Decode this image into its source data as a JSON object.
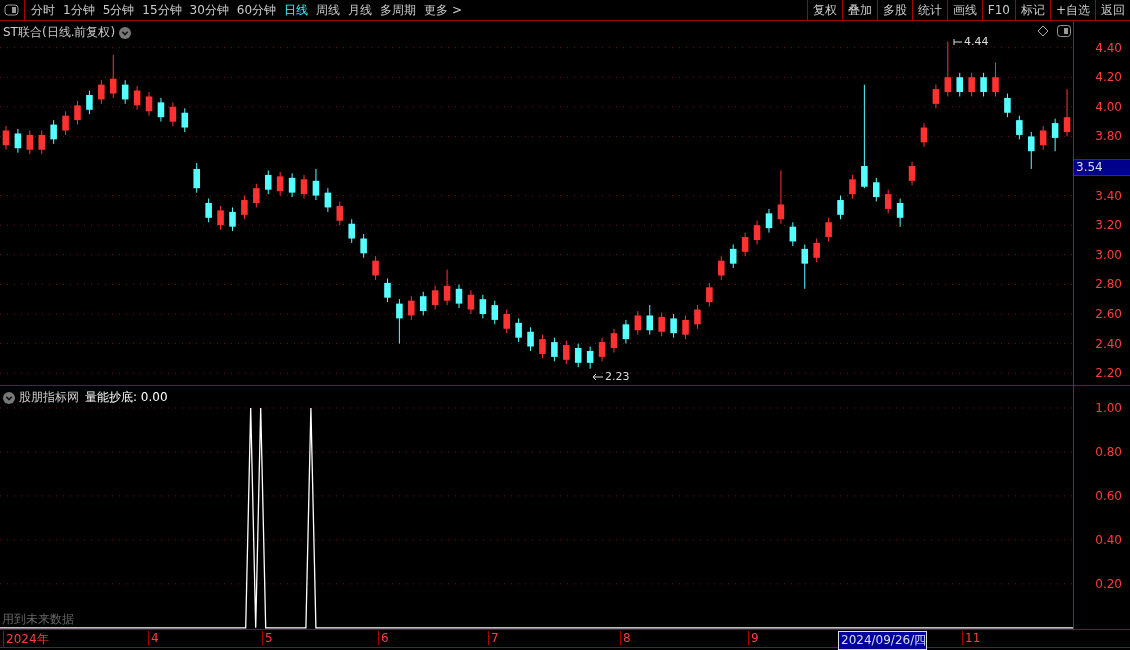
{
  "toolbar": {
    "periods": [
      {
        "label": "分时",
        "selected": false
      },
      {
        "label": "1分钟",
        "selected": false
      },
      {
        "label": "5分钟",
        "selected": false
      },
      {
        "label": "15分钟",
        "selected": false
      },
      {
        "label": "30分钟",
        "selected": false
      },
      {
        "label": "60分钟",
        "selected": false
      },
      {
        "label": "日线",
        "selected": true
      },
      {
        "label": "周线",
        "selected": false
      },
      {
        "label": "月线",
        "selected": false
      },
      {
        "label": "多周期",
        "selected": false
      },
      {
        "label": "更多 >",
        "selected": false
      }
    ],
    "buttons": [
      "复权",
      "叠加",
      "多股",
      "统计",
      "画线",
      "F10",
      "标记",
      "+自选",
      "返回"
    ]
  },
  "main_chart": {
    "title": "ST联合(日线.前复权)",
    "current_price": "3.54",
    "high_marker": "4.44",
    "low_marker": "2.23",
    "chart_data": {
      "type": "candlestick",
      "grid": true,
      "ylim": [
        2.12,
        4.58
      ],
      "categories": [
        null,
        null,
        null,
        null,
        null,
        null,
        null,
        null,
        null,
        null,
        null,
        null,
        null,
        null,
        null,
        null,
        null,
        null,
        null,
        null,
        null,
        null,
        null,
        null,
        null,
        null,
        null,
        null,
        null,
        null,
        null,
        null,
        null,
        null,
        null,
        null,
        null,
        null,
        null,
        null,
        null,
        null,
        null,
        null,
        null,
        null,
        null,
        null,
        null,
        null,
        null,
        null,
        null,
        null,
        null,
        null,
        null,
        null,
        null,
        null,
        null,
        null,
        null,
        null,
        null,
        null,
        null,
        null,
        null,
        null,
        null,
        null,
        null,
        null,
        null,
        null,
        null,
        null,
        null,
        null,
        null,
        null,
        null,
        null,
        null,
        null,
        null,
        null,
        null,
        null
      ],
      "ohlc": [
        [
          3.74,
          3.87,
          3.71,
          3.84
        ],
        [
          3.82,
          3.85,
          3.69,
          3.72
        ],
        [
          3.71,
          3.84,
          3.68,
          3.81
        ],
        [
          3.71,
          3.84,
          3.68,
          3.81
        ],
        [
          3.88,
          3.91,
          3.75,
          3.78
        ],
        [
          3.84,
          3.97,
          3.81,
          3.94
        ],
        [
          3.91,
          4.04,
          3.88,
          4.01
        ],
        [
          4.08,
          4.11,
          3.95,
          3.98
        ],
        [
          4.05,
          4.18,
          4.02,
          4.15
        ],
        [
          4.09,
          4.35,
          4.06,
          4.19
        ],
        [
          4.15,
          4.18,
          4.02,
          4.05
        ],
        [
          4.01,
          4.14,
          3.98,
          4.11
        ],
        [
          3.97,
          4.1,
          3.94,
          4.07
        ],
        [
          4.03,
          4.06,
          3.9,
          3.93
        ],
        [
          3.9,
          4.03,
          3.87,
          4.0
        ],
        [
          3.96,
          3.99,
          3.83,
          3.86
        ],
        [
          3.58,
          3.62,
          3.42,
          3.45
        ],
        [
          3.35,
          3.38,
          3.22,
          3.25
        ],
        [
          3.2,
          3.33,
          3.17,
          3.3
        ],
        [
          3.29,
          3.32,
          3.16,
          3.19
        ],
        [
          3.27,
          3.4,
          3.24,
          3.37
        ],
        [
          3.35,
          3.48,
          3.32,
          3.45
        ],
        [
          3.54,
          3.57,
          3.41,
          3.44
        ],
        [
          3.43,
          3.56,
          3.4,
          3.53
        ],
        [
          3.52,
          3.55,
          3.39,
          3.42
        ],
        [
          3.41,
          3.54,
          3.38,
          3.51
        ],
        [
          3.5,
          3.58,
          3.37,
          3.4
        ],
        [
          3.42,
          3.45,
          3.29,
          3.32
        ],
        [
          3.23,
          3.36,
          3.2,
          3.33
        ],
        [
          3.21,
          3.24,
          3.08,
          3.11
        ],
        [
          3.11,
          3.14,
          2.98,
          3.01
        ],
        [
          2.86,
          2.99,
          2.83,
          2.96
        ],
        [
          2.81,
          2.84,
          2.68,
          2.71
        ],
        [
          2.67,
          2.7,
          2.4,
          2.57
        ],
        [
          2.59,
          2.72,
          2.56,
          2.69
        ],
        [
          2.72,
          2.75,
          2.59,
          2.62
        ],
        [
          2.66,
          2.79,
          2.63,
          2.76
        ],
        [
          2.69,
          2.9,
          2.66,
          2.79
        ],
        [
          2.77,
          2.8,
          2.64,
          2.67
        ],
        [
          2.63,
          2.76,
          2.6,
          2.73
        ],
        [
          2.7,
          2.73,
          2.57,
          2.6
        ],
        [
          2.66,
          2.69,
          2.53,
          2.56
        ],
        [
          2.5,
          2.63,
          2.47,
          2.6
        ],
        [
          2.54,
          2.57,
          2.41,
          2.44
        ],
        [
          2.48,
          2.51,
          2.35,
          2.38
        ],
        [
          2.33,
          2.46,
          2.3,
          2.43
        ],
        [
          2.41,
          2.44,
          2.28,
          2.31
        ],
        [
          2.29,
          2.42,
          2.26,
          2.39
        ],
        [
          2.37,
          2.4,
          2.24,
          2.27
        ],
        [
          2.35,
          2.38,
          2.23,
          2.27
        ],
        [
          2.31,
          2.44,
          2.28,
          2.41
        ],
        [
          2.37,
          2.5,
          2.34,
          2.47
        ],
        [
          2.53,
          2.56,
          2.4,
          2.43
        ],
        [
          2.49,
          2.62,
          2.46,
          2.59
        ],
        [
          2.59,
          2.66,
          2.46,
          2.49
        ],
        [
          2.48,
          2.61,
          2.45,
          2.58
        ],
        [
          2.57,
          2.6,
          2.44,
          2.47
        ],
        [
          2.46,
          2.59,
          2.43,
          2.56
        ],
        [
          2.53,
          2.66,
          2.5,
          2.63
        ],
        [
          2.68,
          2.81,
          2.65,
          2.78
        ],
        [
          2.86,
          2.99,
          2.83,
          2.96
        ],
        [
          3.04,
          3.07,
          2.91,
          2.94
        ],
        [
          3.02,
          3.15,
          2.99,
          3.12
        ],
        [
          3.1,
          3.23,
          3.07,
          3.2
        ],
        [
          3.28,
          3.31,
          3.15,
          3.18
        ],
        [
          3.24,
          3.57,
          3.21,
          3.34
        ],
        [
          3.19,
          3.22,
          3.06,
          3.09
        ],
        [
          3.04,
          3.07,
          2.77,
          2.94
        ],
        [
          2.98,
          3.11,
          2.95,
          3.08
        ],
        [
          3.12,
          3.25,
          3.09,
          3.22
        ],
        [
          3.37,
          3.4,
          3.24,
          3.27
        ],
        [
          3.41,
          3.54,
          3.38,
          3.51
        ],
        [
          3.6,
          4.15,
          3.45,
          3.46
        ],
        [
          3.49,
          3.52,
          3.36,
          3.39
        ],
        [
          3.31,
          3.44,
          3.28,
          3.41
        ],
        [
          3.35,
          3.38,
          3.19,
          3.25
        ],
        [
          3.5,
          3.63,
          3.47,
          3.6
        ],
        [
          3.76,
          3.89,
          3.73,
          3.86
        ],
        [
          4.02,
          4.15,
          3.99,
          4.12
        ],
        [
          4.1,
          4.44,
          4.07,
          4.2
        ],
        [
          4.2,
          4.23,
          4.07,
          4.1
        ],
        [
          4.1,
          4.23,
          4.07,
          4.2
        ],
        [
          4.2,
          4.23,
          4.07,
          4.1
        ],
        [
          4.1,
          4.3,
          4.07,
          4.2
        ],
        [
          4.06,
          4.09,
          3.93,
          3.96
        ],
        [
          3.91,
          3.94,
          3.78,
          3.81
        ],
        [
          3.8,
          3.83,
          3.58,
          3.7
        ],
        [
          3.74,
          3.87,
          3.71,
          3.84
        ],
        [
          3.89,
          3.92,
          3.7,
          3.79
        ],
        [
          3.83,
          4.12,
          3.8,
          3.93
        ]
      ],
      "yticks": [
        {
          "value": 4.4,
          "label": "4.40"
        },
        {
          "value": 4.2,
          "label": "4.20"
        },
        {
          "value": 4.0,
          "label": "4.00"
        },
        {
          "value": 3.8,
          "label": "3.80"
        },
        {
          "value": 3.4,
          "label": "3.40"
        },
        {
          "value": 3.2,
          "label": "3.20"
        },
        {
          "value": 3.0,
          "label": "3.00"
        },
        {
          "value": 2.8,
          "label": "2.80"
        },
        {
          "value": 2.6,
          "label": "2.60"
        },
        {
          "value": 2.4,
          "label": "2.40"
        },
        {
          "value": 2.2,
          "label": "2.20"
        }
      ]
    }
  },
  "indicator": {
    "source": "股朋指标网",
    "title": "量能抄底: 0.00",
    "note": "用到未来数据",
    "chart_data": {
      "type": "line",
      "grid": true,
      "ylim": [
        -0.01,
        1.1
      ],
      "categories": [
        null,
        null,
        null,
        null,
        null,
        null,
        null,
        null,
        null,
        null,
        null,
        null,
        null,
        null,
        null,
        null,
        null,
        null,
        null,
        null,
        null,
        null,
        null,
        null,
        null,
        null,
        null,
        null,
        null,
        null,
        null,
        null,
        null,
        null,
        null,
        null,
        null,
        null,
        null,
        null,
        null,
        null,
        null,
        null,
        null,
        null,
        null,
        null,
        null,
        null,
        null,
        null,
        null,
        null,
        null,
        null,
        null,
        null,
        null,
        null,
        null,
        null,
        null,
        null,
        null,
        null,
        null,
        null,
        null,
        null,
        null,
        null,
        null,
        null,
        null,
        null,
        null,
        null,
        null,
        null,
        null,
        null,
        null,
        null,
        null,
        null,
        null,
        null,
        null,
        null,
        null,
        null,
        null,
        null,
        null,
        null,
        null,
        null,
        null,
        null,
        null,
        null,
        null,
        null,
        null,
        null,
        null,
        null,
        null,
        null,
        null,
        null,
        null,
        null,
        null,
        null,
        null,
        null,
        null,
        null,
        null,
        null,
        null,
        null,
        null,
        null,
        null,
        null,
        null,
        null,
        null,
        null,
        null,
        null,
        null,
        null,
        null,
        null,
        null,
        null,
        null,
        null,
        null,
        null,
        null,
        null,
        null,
        null,
        null,
        null,
        null,
        null,
        null,
        null,
        null,
        null,
        null,
        null,
        null,
        null,
        null,
        null,
        null,
        null,
        null,
        null,
        null,
        null,
        null,
        null,
        null,
        null,
        null,
        null,
        null,
        null,
        null,
        null,
        null,
        null,
        null,
        null,
        null,
        null,
        null,
        null,
        null,
        null,
        null,
        null,
        null,
        null,
        null,
        null,
        null,
        null,
        null,
        null,
        null,
        null,
        null,
        null,
        null,
        null,
        null,
        null,
        null,
        null,
        null,
        null,
        null,
        null,
        null,
        null,
        null
      ],
      "series": [
        {
          "color": "#ffffff",
          "values": [
            0,
            0,
            0,
            0,
            0,
            0,
            0,
            0,
            0,
            0,
            0,
            0,
            0,
            0,
            0,
            0,
            0,
            0,
            0,
            0,
            0,
            0,
            0,
            0,
            0,
            0,
            0,
            0,
            0,
            0,
            0,
            0,
            0,
            0,
            0,
            0,
            0,
            0,
            0,
            0,
            0,
            0,
            0,
            0,
            0,
            0,
            0,
            0,
            0,
            0,
            1,
            0,
            1,
            0,
            0,
            0,
            0,
            0,
            0,
            0,
            0,
            0,
            1,
            0,
            0,
            0,
            0,
            0,
            0,
            0,
            0,
            0,
            0,
            0,
            0,
            0,
            0,
            0,
            0,
            0,
            0,
            0,
            0,
            0,
            0,
            0,
            0,
            0,
            0,
            0,
            0,
            0,
            0,
            0,
            0,
            0,
            0,
            0,
            0,
            0,
            0,
            0,
            0,
            0,
            0,
            0,
            0,
            0,
            0,
            0,
            0,
            0,
            0,
            0,
            0,
            0,
            0,
            0,
            0,
            0,
            0,
            0,
            0,
            0,
            0,
            0,
            0,
            0,
            0,
            0,
            0,
            0,
            0,
            0,
            0,
            0,
            0,
            0,
            0,
            0,
            0,
            0,
            0,
            0,
            0,
            0,
            0,
            0,
            0,
            0,
            0,
            0,
            0,
            0,
            0,
            0,
            0,
            0,
            0,
            0,
            0,
            0,
            0,
            0,
            0,
            0,
            0,
            0,
            0,
            0,
            0,
            0,
            0,
            0,
            0,
            0,
            0,
            0,
            0,
            0,
            0,
            0,
            0,
            0,
            0,
            0,
            0,
            0,
            0,
            0,
            0,
            0,
            0,
            0,
            0,
            0,
            0,
            0,
            0,
            0,
            0,
            0,
            0,
            0,
            0,
            0,
            0,
            0,
            0,
            0,
            0,
            0,
            0,
            0,
            0
          ]
        }
      ],
      "yticks": [
        {
          "value": 1,
          "label": "1.00"
        },
        {
          "value": 0.8,
          "label": "0.80"
        },
        {
          "value": 0.6,
          "label": "0.60"
        },
        {
          "value": 0.4,
          "label": "0.40"
        },
        {
          "value": 0.2,
          "label": "0.20"
        }
      ]
    }
  },
  "date_axis": [
    {
      "label": "2024年",
      "selected": false
    },
    {
      "label": "4",
      "selected": false
    },
    {
      "label": "5",
      "selected": false
    },
    {
      "label": "6",
      "selected": false
    },
    {
      "label": "7",
      "selected": false
    },
    {
      "label": "8",
      "selected": false
    },
    {
      "label": "9",
      "selected": false
    },
    {
      "label": "2024/09/26/四",
      "selected": true
    },
    {
      "label": "11",
      "selected": false
    }
  ]
}
